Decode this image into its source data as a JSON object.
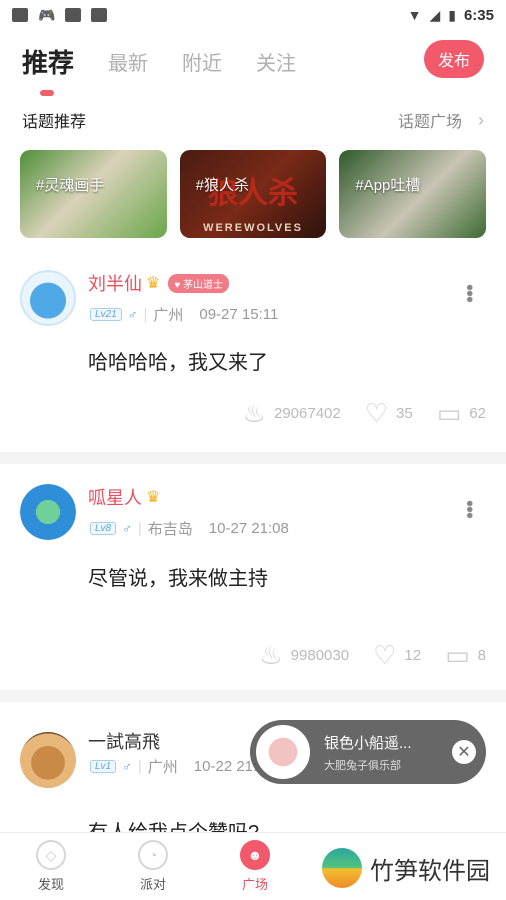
{
  "status_bar": {
    "time": "6:35"
  },
  "top_tabs": [
    {
      "label": "推荐",
      "active": true
    },
    {
      "label": "最新",
      "active": false
    },
    {
      "label": "附近",
      "active": false
    },
    {
      "label": "关注",
      "active": false
    }
  ],
  "publish_label": "发布",
  "topics": {
    "title": "话题推荐",
    "more_label": "话题广场",
    "cards": [
      {
        "label": "#灵魂画手"
      },
      {
        "label": "#狼人杀",
        "art_text": "WEREWOLVES"
      },
      {
        "label": "#App吐槽"
      }
    ]
  },
  "posts": [
    {
      "name": "刘半仙",
      "badge": "茅山道士",
      "level": "Lv21",
      "gender": "♂",
      "location": "广州",
      "time": "09-27 15:11",
      "content": "哈哈哈哈，我又来了",
      "views": "29067402",
      "likes": "35",
      "comments": "62"
    },
    {
      "name": "呱星人",
      "level": "Lv8",
      "gender": "♂",
      "location": "布吉岛",
      "time": "10-27 21:08",
      "content": "尽管说，我来做主持",
      "views": "9980030",
      "likes": "12",
      "comments": "8"
    },
    {
      "name": "一試高飛",
      "level": "Lv1",
      "gender": "♂",
      "location": "广州",
      "time": "10-22 21:",
      "content": "有人给我点个赞吗?"
    }
  ],
  "float_player": {
    "title": "银色小船遥...",
    "subtitle": "大肥兔子俱乐部"
  },
  "bottom_nav": [
    {
      "label": "发现",
      "icon": "compass-icon"
    },
    {
      "label": "派对",
      "icon": "party-icon"
    },
    {
      "label": "广场",
      "icon": "plaza-icon",
      "active": true
    }
  ],
  "watermark": "竹笋软件园",
  "colors": {
    "accent": "#f2596a",
    "name_red": "#e9505f",
    "level_blue": "#5fa8d8"
  }
}
